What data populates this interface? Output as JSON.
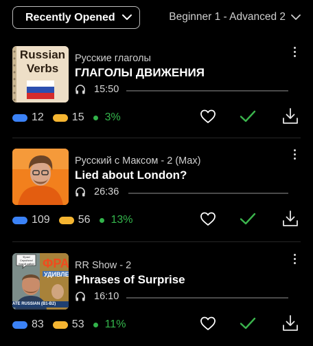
{
  "toolbar": {
    "sort_label": "Recently Opened",
    "level_label": "Beginner 1 - Advanced 2"
  },
  "thumb1": {
    "line1": "Russian",
    "line2": "Verbs"
  },
  "thumb3": {
    "bubble": "Фраз! Серьёзно! Какой кайф!",
    "big": "ФРА",
    "strip": "УДИВЛЕ",
    "badge": "ATE RUSSIAN (B1-B2)"
  },
  "items": [
    {
      "channel": "Русские глаголы",
      "title": "ГЛАГОЛЫ ДВИЖЕНИЯ",
      "duration": "15:50",
      "blue_count": "12",
      "yellow_count": "15",
      "percent": "3%"
    },
    {
      "channel": "Русский с Максом - 2 (Max)",
      "title": "Lied about London?",
      "duration": "26:36",
      "blue_count": "109",
      "yellow_count": "56",
      "percent": "13%"
    },
    {
      "channel": "RR Show - 2",
      "title": "Phrases of Surprise",
      "duration": "16:10",
      "blue_count": "83",
      "yellow_count": "53",
      "percent": "11%"
    }
  ],
  "icons": {
    "heart": "heart-icon",
    "check": "check-icon",
    "download": "download-icon",
    "headphones": "headphones-icon",
    "more": "more-vertical-icon"
  },
  "colors": {
    "blue_pill": "#3b82f6",
    "yellow_pill": "#f5b531",
    "green": "#34b64c",
    "background": "#000000"
  }
}
